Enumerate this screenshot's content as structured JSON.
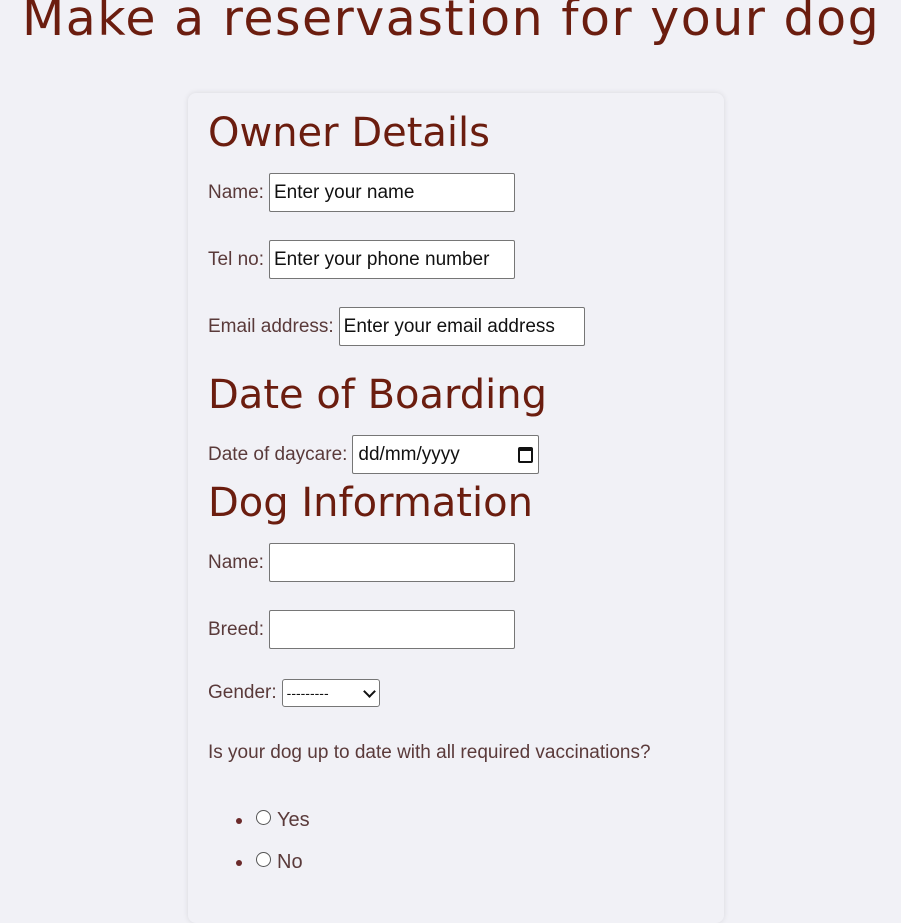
{
  "page": {
    "title": "Make a reservastion for your dog"
  },
  "owner": {
    "heading": "Owner Details",
    "name_label": "Name:",
    "name_placeholder": "Enter your name",
    "tel_label": "Tel no:",
    "tel_placeholder": "Enter your phone number",
    "email_label": "Email address:",
    "email_placeholder": "Enter your email address"
  },
  "boarding": {
    "heading": "Date of Boarding",
    "date_label": "Date of daycare:",
    "date_value": "dd/mm/yyyy",
    "date_icon": "calendar-icon"
  },
  "dog": {
    "heading": "Dog Information",
    "name_label": "Name:",
    "name_value": "",
    "breed_label": "Breed:",
    "breed_value": "",
    "gender_label": "Gender:",
    "gender_selected": "---------",
    "vaccination_question": "Is your dog up to date with all required vaccinations?",
    "options": [
      "Yes",
      "No"
    ]
  },
  "colors": {
    "background": "#f1f1f6",
    "heading": "#6b1d0f",
    "label": "#5a3a3a"
  }
}
